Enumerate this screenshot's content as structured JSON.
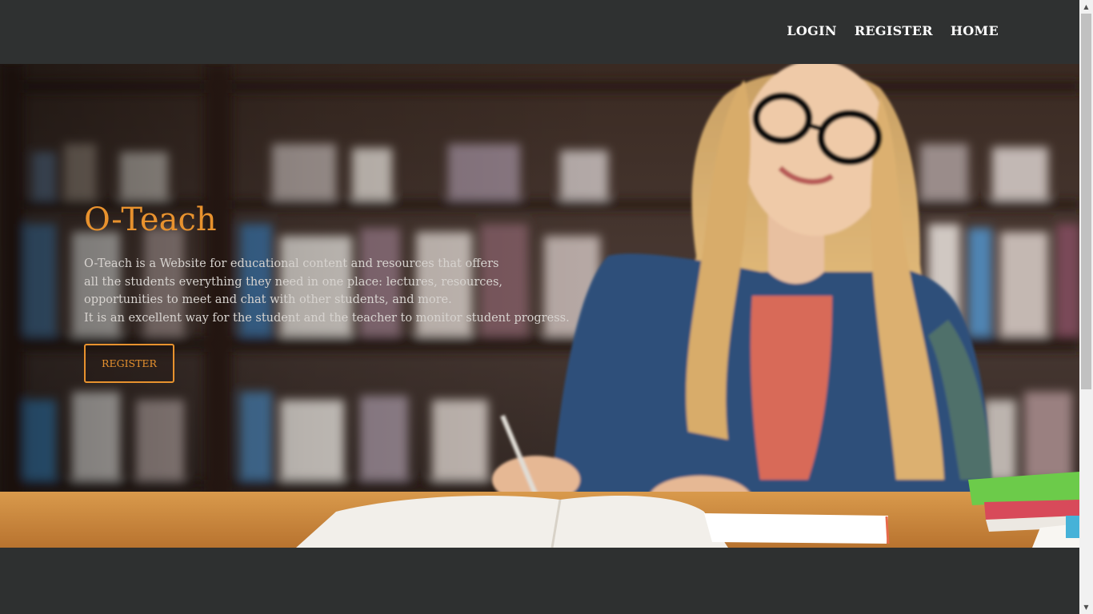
{
  "nav": {
    "links": [
      "LOGIN",
      "REGISTER",
      "HOME"
    ]
  },
  "hero": {
    "title": "O-Teach",
    "description_lines": [
      "O-Teach is a Website for educational content and resources that offers",
      "all the students everything they need in one place: lectures, resources,",
      "opportunities to meet and chat with other students, and more.",
      "It is an excellent way for the student and the teacher to monitor student progress."
    ],
    "button_label": "REGISTER"
  },
  "scrollbar": {
    "up_icon": "chevron-up-icon",
    "down_icon": "chevron-down-icon"
  },
  "colors": {
    "accent": "#e8922e",
    "navbar_bg": "#2f3131",
    "page_bg": "#2e3030",
    "nav_text": "#ffffff"
  }
}
